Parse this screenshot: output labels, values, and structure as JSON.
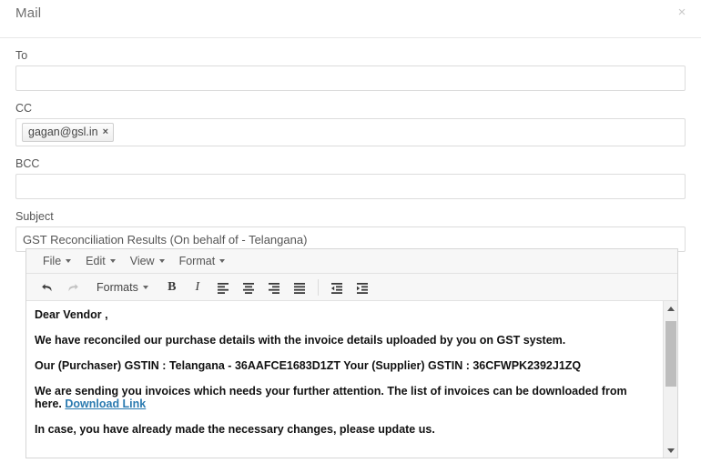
{
  "header": {
    "title": "Mail",
    "close_icon": "close-icon",
    "close_label": "×"
  },
  "form": {
    "to": {
      "label": "To",
      "value": "",
      "placeholder": ""
    },
    "cc": {
      "label": "CC",
      "chips": [
        {
          "text": "gagan@gsl.in",
          "remove_label": "×"
        }
      ],
      "placeholder": ""
    },
    "bcc": {
      "label": "BCC",
      "value": "",
      "placeholder": ""
    },
    "subject": {
      "label": "Subject",
      "value": "GST Reconciliation Results (On behalf of - Telangana)",
      "placeholder": ""
    }
  },
  "editor": {
    "menu": [
      {
        "label": "File",
        "icon": "chevron-down-icon"
      },
      {
        "label": "Edit",
        "icon": "chevron-down-icon"
      },
      {
        "label": "View",
        "icon": "chevron-down-icon"
      },
      {
        "label": "Format",
        "icon": "chevron-down-icon"
      }
    ],
    "toolbar": {
      "undo": {
        "icon": "undo-icon",
        "enabled": true
      },
      "redo": {
        "icon": "redo-icon",
        "enabled": false
      },
      "formats": {
        "label": "Formats",
        "icon": "chevron-down-icon"
      },
      "bold": {
        "label": "B",
        "icon": "bold-icon"
      },
      "italic": {
        "label": "I",
        "icon": "italic-icon"
      },
      "align_left": {
        "icon": "align-left-icon"
      },
      "align_center": {
        "icon": "align-center-icon"
      },
      "align_right": {
        "icon": "align-right-icon"
      },
      "align_justify": {
        "icon": "align-justify-icon"
      },
      "outdent": {
        "icon": "outdent-icon"
      },
      "indent": {
        "icon": "indent-icon"
      }
    },
    "body": {
      "greeting": "Dear Vendor ,",
      "paragraph_1": "We have reconciled our purchase details with the invoice details uploaded by you on GST system.",
      "paragraph_2": "Our (Purchaser) GSTIN : Telangana - 36AAFCE1683D1ZT  Your (Supplier) GSTIN : 36CFWPK2392J1ZQ",
      "paragraph_3_text": "We are sending you invoices which needs your further attention. The list of invoices can be downloaded from here. ",
      "paragraph_3_link": "Download Link",
      "paragraph_4": "In case, you have already made the necessary changes, please update us."
    },
    "scrollbar": {
      "up_icon": "scroll-up-arrow-icon",
      "down_icon": "scroll-down-arrow-icon",
      "thumb": "scrollbar-thumb"
    }
  },
  "colors": {
    "link": "#2a7ab0",
    "border": "#dcdcdc",
    "toolbar_bg": "#f7f7f7",
    "title_text": "#6f6f6f"
  }
}
